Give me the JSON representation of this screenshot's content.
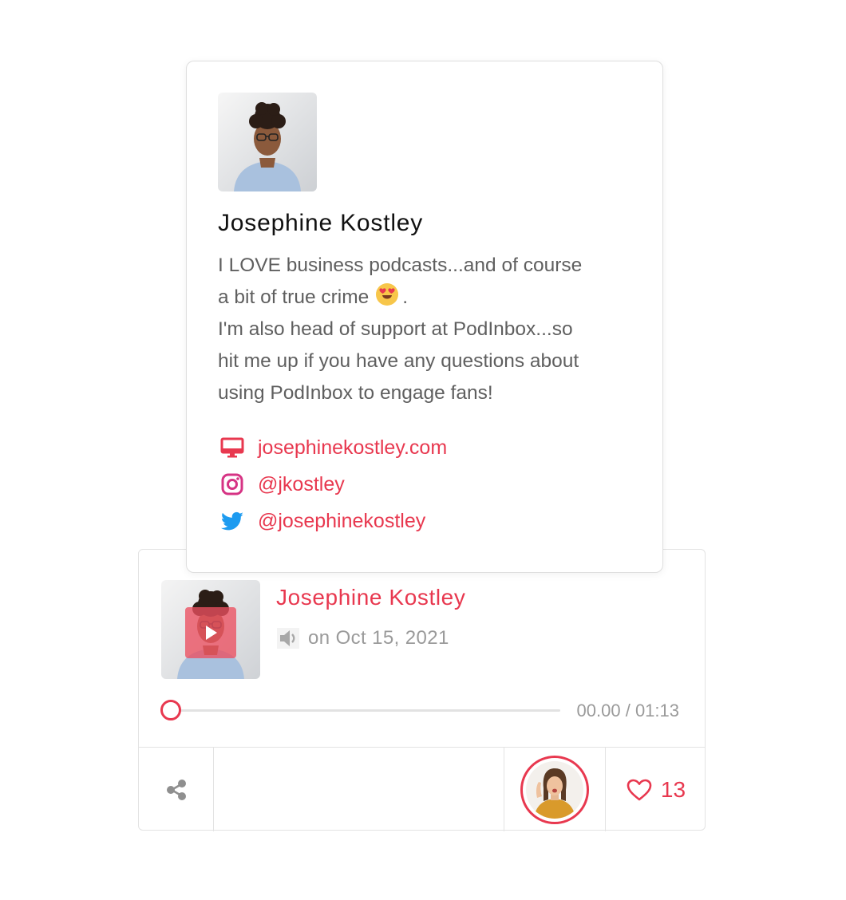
{
  "profile": {
    "name": "Josephine Kostley",
    "bio": {
      "line1": "I LOVE business podcasts...and of course",
      "line2_text": "a bit of true crime",
      "line2_end": ".",
      "line3": "I'm also head of support at PodInbox...so",
      "line4": "hit me up if you have any questions about",
      "line5": "using PodInbox to engage fans!"
    },
    "links": [
      {
        "icon": "monitor-icon",
        "label": "josephinekostley.com"
      },
      {
        "icon": "instagram-icon",
        "label": "@jkostley"
      },
      {
        "icon": "twitter-icon",
        "label": "@josephinekostley"
      }
    ]
  },
  "message": {
    "sender": "Josephine Kostley",
    "date_text": "on Oct 15, 2021",
    "time_display": "00.00 / 01:13",
    "progress": 0,
    "like_count": "13"
  },
  "colors": {
    "accent": "#e8384f",
    "muted_text": "#9a9a9a",
    "body_text": "#5f5f5f",
    "border": "#e3e3e3",
    "twitter_blue": "#1d9bf0",
    "instagram": "#d63384"
  }
}
